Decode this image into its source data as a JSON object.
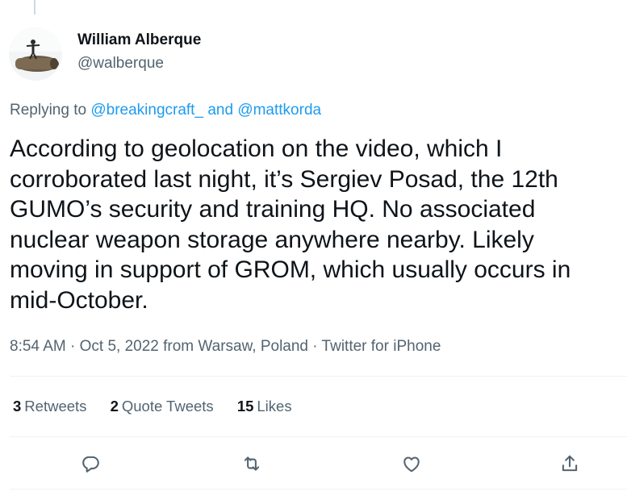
{
  "author": {
    "display_name": "William Alberque",
    "handle": "@walberque",
    "avatar_icon": "avatar-photo-icon"
  },
  "replying": {
    "prefix": "Replying to",
    "mention1": "@breakingcraft_",
    "joiner": "and",
    "mention2": "@mattkorda"
  },
  "tweet": {
    "text": "According to geolocation on the video, which I\ncorroborated last night, it’s Sergiev Posad, the 12th\nGUMO’s security and training HQ. No associated\nnuclear weapon storage anywhere nearby. Likely\nmoving in support of GROM, which usually occurs in\nmid-October."
  },
  "meta": {
    "time": "8:54 AM",
    "date": "Oct 5, 2022",
    "location": "from Warsaw, Poland",
    "source": "Twitter for iPhone",
    "separator": "·"
  },
  "stats": {
    "retweets_count": "3",
    "retweets_label": "Retweets",
    "quotes_count": "2",
    "quotes_label": "Quote Tweets",
    "likes_count": "15",
    "likes_label": "Likes"
  },
  "actions": {
    "reply_icon": "reply-icon",
    "retweet_icon": "retweet-icon",
    "like_icon": "like-icon",
    "share_icon": "share-icon"
  },
  "colors": {
    "link": "#1d9bf0",
    "secondary_text": "#536471",
    "primary_text": "#0f1419",
    "divider": "#eff3f4"
  }
}
